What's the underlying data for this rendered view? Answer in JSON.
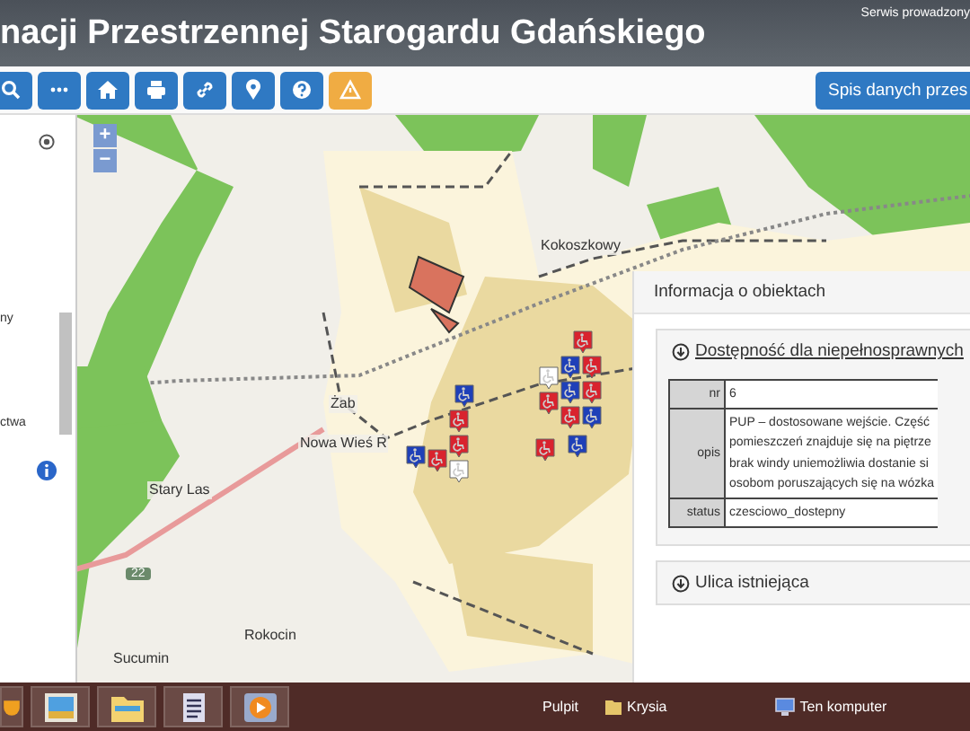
{
  "header": {
    "title": "nacji Przestrzennej Starogardu Gdańskiego",
    "service_note": "Serwis prowadzony"
  },
  "toolbar": {
    "buttons": [
      {
        "kind": "search"
      },
      {
        "kind": "more"
      },
      {
        "kind": "home"
      },
      {
        "kind": "print"
      },
      {
        "kind": "link"
      },
      {
        "kind": "pin"
      },
      {
        "kind": "help"
      },
      {
        "kind": "warning"
      }
    ],
    "list_button": "Spis danych przes"
  },
  "left_panel": {
    "fragments": [
      "ny",
      "ctwa"
    ]
  },
  "map": {
    "zoom_in": "+",
    "zoom_out": "−",
    "road_number": "22",
    "places": [
      "Kokoszkowy",
      "Żab",
      "Nowa Wieś R",
      "Stary Las",
      "Rokocin",
      "Sucumin"
    ],
    "markers": [
      {
        "color": "#d9232e"
      },
      {
        "color": "#1f40b8"
      },
      {
        "color": "#d9232e"
      },
      {
        "color": "#ffffff"
      },
      {
        "color": "#d9232e"
      },
      {
        "color": "#d9232e"
      },
      {
        "color": "#1f40b8"
      },
      {
        "color": "#1f40b8"
      },
      {
        "color": "#d9232e"
      },
      {
        "color": "#1f40b8"
      },
      {
        "color": "#d9232e"
      },
      {
        "color": "#d9232e"
      },
      {
        "color": "#1f40b8"
      },
      {
        "color": "#d9232e"
      },
      {
        "color": "#ffffff"
      },
      {
        "color": "#d9232e"
      },
      {
        "color": "#1f40b8"
      }
    ]
  },
  "info_panel": {
    "title": "Informacja o obiektach",
    "sections": [
      {
        "title": "Dostępność dla niepełnosprawnych",
        "expanded": true,
        "rows": [
          {
            "label": "nr",
            "lines": [
              "6"
            ]
          },
          {
            "label": "opis",
            "lines": [
              "PUP – dostosowane wejście. Część",
              "pomieszczeń znajduje się na piętrze",
              "brak windy uniemożliwia dostanie si",
              "osobom poruszających się na wózka"
            ]
          },
          {
            "label": "status",
            "lines": [
              "czesciowo_dostepny"
            ]
          }
        ]
      },
      {
        "title": "Ulica istniejąca",
        "expanded": false
      }
    ]
  },
  "taskbar": {
    "apps": [
      {
        "kind": "shield"
      },
      {
        "kind": "pictures"
      },
      {
        "kind": "folder"
      },
      {
        "kind": "document"
      },
      {
        "kind": "media"
      }
    ],
    "desktop_label": "Pulpit",
    "user": "Krysia",
    "computer": "Ten komputer"
  }
}
